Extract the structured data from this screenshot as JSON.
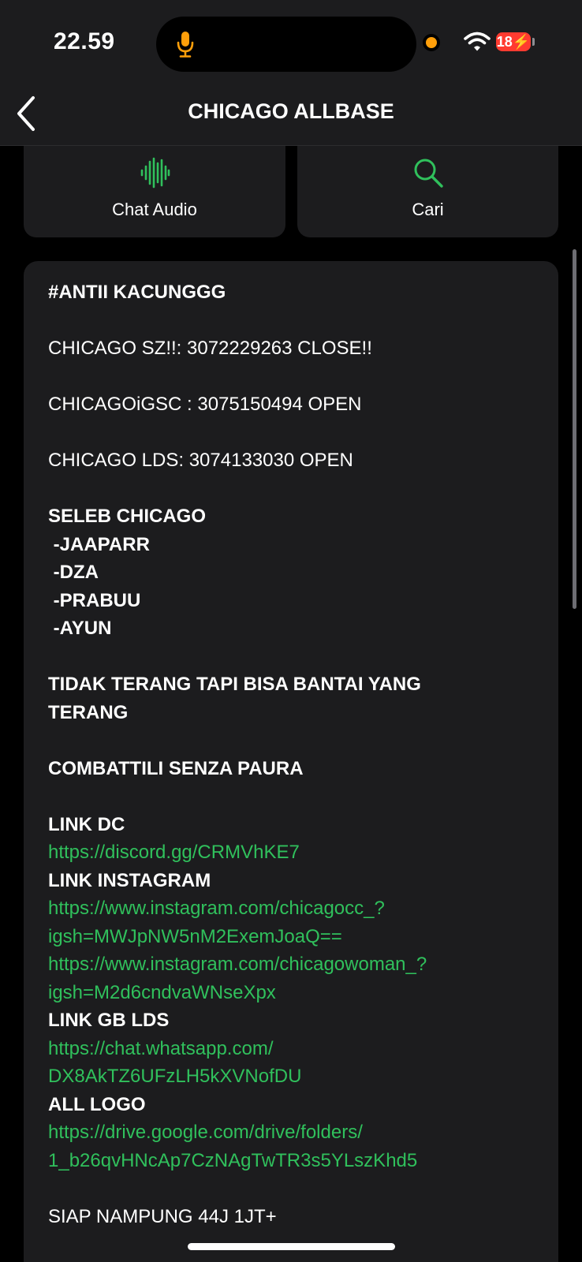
{
  "status_bar": {
    "time": "22.59",
    "battery": "18"
  },
  "nav": {
    "title": "CHICAGO ALLBASE"
  },
  "actions": {
    "audio_label": "Chat Audio",
    "search_label": "Cari"
  },
  "colors": {
    "accent": "#30c05c",
    "background": "#000000",
    "card": "#1c1c1e",
    "battery_low": "#ff3b30",
    "mic_indicator": "#ff9f0a"
  },
  "icons": {
    "back": "chevron-left-icon",
    "audio": "audio-waveform-icon",
    "search": "magnifier-icon",
    "mic": "microphone-icon",
    "wifi": "wifi-icon"
  },
  "description": {
    "tag": "#ANTII KACUNGGG",
    "group_1": "CHICAGO SZ!!: 3072229263 CLOSE!!",
    "group_2": "CHICAGOiGSC : 3075150494 OPEN",
    "group_3": "CHICAGO LDS: 3074133030 OPEN",
    "seleb_heading": "SELEB CHICAGO",
    "seleb": [
      " -JAAPARR",
      " -DZA",
      " -PRABUU",
      " -AYUN"
    ],
    "motto_1": "TIDAK TERANG TAPI BISA BANTAI YANG",
    "motto_1b": "TERANG",
    "motto_2": "COMBATTILI SENZA PAURA",
    "link_dc_label": "LINK DC",
    "link_dc_url": "https://discord.gg/CRMVhKE7",
    "link_ig_label": "LINK INSTAGRAM",
    "link_ig_1a": "https://www.instagram.com/chicagocc_?",
    "link_ig_1b": "igsh=MWJpNW5nM2ExemJoaQ==",
    "link_ig_2a": "https://www.instagram.com/chicagowoman_?",
    "link_ig_2b": "igsh=M2d6cndvaWNseXpx",
    "link_gb_label": "LINK GB LDS",
    "link_gb_a": "https://chat.whatsapp.com/",
    "link_gb_b": "DX8AkTZ6UFzLH5kXVNofDU",
    "logo_label": "ALL LOGO",
    "logo_a": "https://drive.google.com/drive/folders/",
    "logo_b": "1_b26qvHNcAp7CzNAgTwTR3s5YLszKhd5",
    "closing": "SIAP NAMPUNG 44J 1JT+"
  }
}
